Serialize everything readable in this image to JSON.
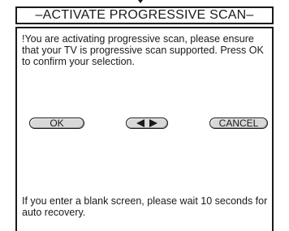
{
  "dialog": {
    "title": "–ACTIVATE PROGRESSIVE SCAN–",
    "message": "!You are activating progressive scan, please ensure that your TV is progressive scan supported. Press OK to confirm your selection.",
    "footer": "If you enter a blank screen, please wait 10 seconds for auto recovery."
  },
  "buttons": {
    "ok_label": "OK",
    "cancel_label": "CANCEL",
    "nav_icons": [
      "triangle-left-icon",
      "triangle-right-icon"
    ]
  },
  "colors": {
    "border": "#1a1a1a",
    "button_fill": "#d8d8d8",
    "background": "#ffffff"
  }
}
